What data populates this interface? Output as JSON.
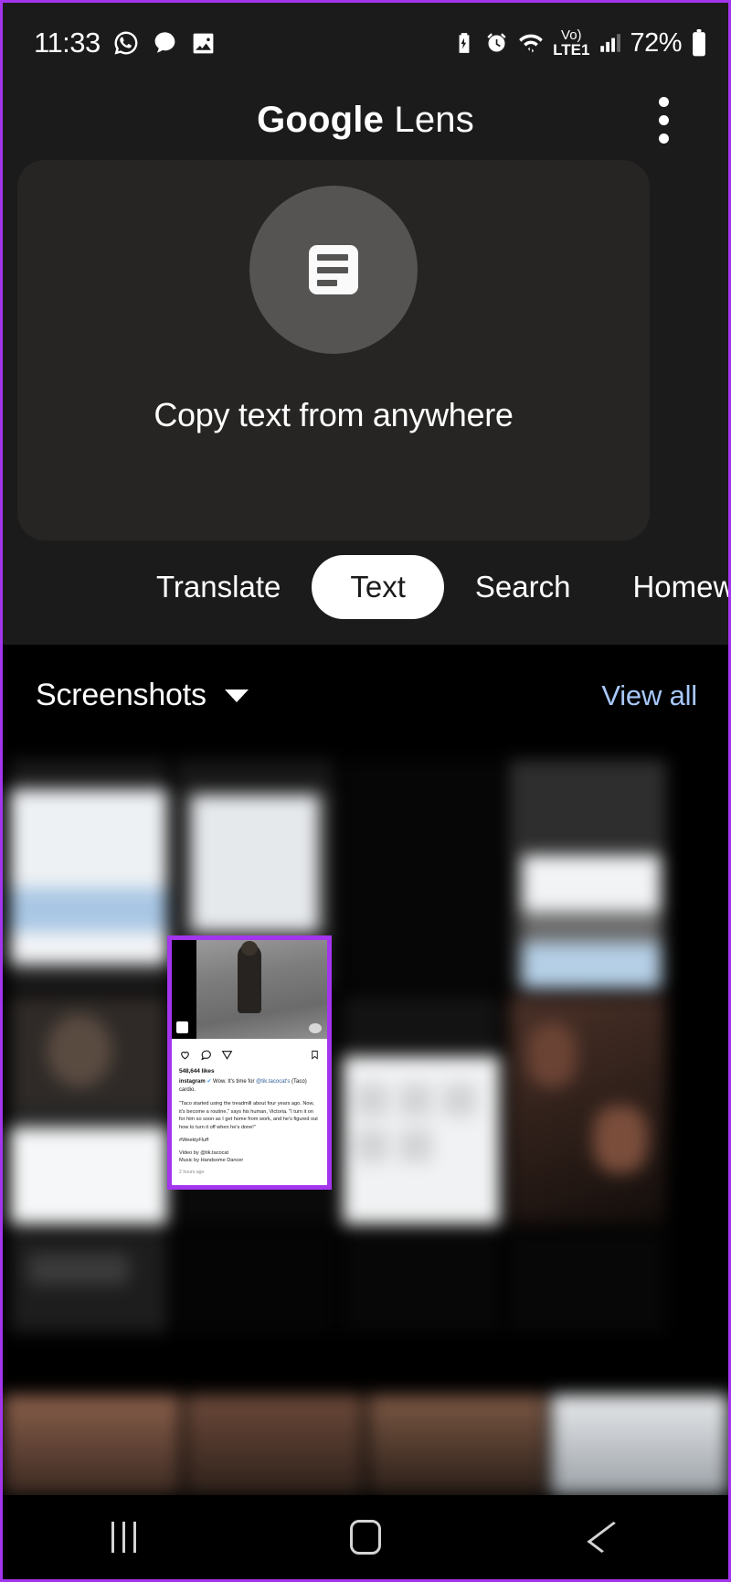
{
  "statusbar": {
    "time": "11:33",
    "left_icons": [
      "whatsapp-icon",
      "chat-bubble-icon",
      "gallery-image-icon"
    ],
    "right_icons": [
      "battery-saver-icon",
      "alarm-icon",
      "wifi-icon",
      "volte-icon",
      "signal-bars-icon"
    ],
    "network_label": "Vo)",
    "network_sub": "LTE1",
    "battery_percent": "72%"
  },
  "lens": {
    "title_bold": "Google",
    "title_light": " Lens",
    "menu_icon": "kebab-menu-icon",
    "hero": {
      "icon": "text-document-icon",
      "caption": "Copy text from anywhere"
    },
    "tabs": [
      {
        "label": "Translate",
        "selected": false
      },
      {
        "label": "Text",
        "selected": true
      },
      {
        "label": "Search",
        "selected": false
      },
      {
        "label": "Homew",
        "selected": false
      }
    ]
  },
  "screenshots": {
    "section_title": "Screenshots",
    "expand_icon": "chevron-down-icon",
    "view_all": "View all",
    "selected_item": {
      "app": "instagram-post-screenshot",
      "actions": [
        "heart-icon",
        "comment-icon",
        "share-icon",
        "bookmark-icon"
      ],
      "likes": "548,644 likes",
      "author": "instagram",
      "verified_icon": "verified-badge-icon",
      "caption": " Wow. It's time for ",
      "mention": "@tik.tacocat's",
      "caption_end": " (Taco) cardio.",
      "body": "\"Taco started using the treadmill about four years ago. Now, it's become a routine,\" says his human, Victoria. \"I turn it on for him so soon as I get home from work, and he's figured out how to turn it off when he's done!\"",
      "hashtag": "#WeeklyFluff",
      "credit_line1": "Video by @tik.tacocat",
      "credit_line2": "Music by Handsome Dancer",
      "timestamp": "2 hours ago"
    }
  },
  "navbar": {
    "recents": "recents-icon",
    "home": "home-icon",
    "back": "back-icon"
  },
  "colors": {
    "accent_purple": "#a335ee",
    "link_blue": "#a8c7fa",
    "panel_bg": "#1c1b1b",
    "card_bg": "#262524",
    "circle_bg": "#555453"
  }
}
